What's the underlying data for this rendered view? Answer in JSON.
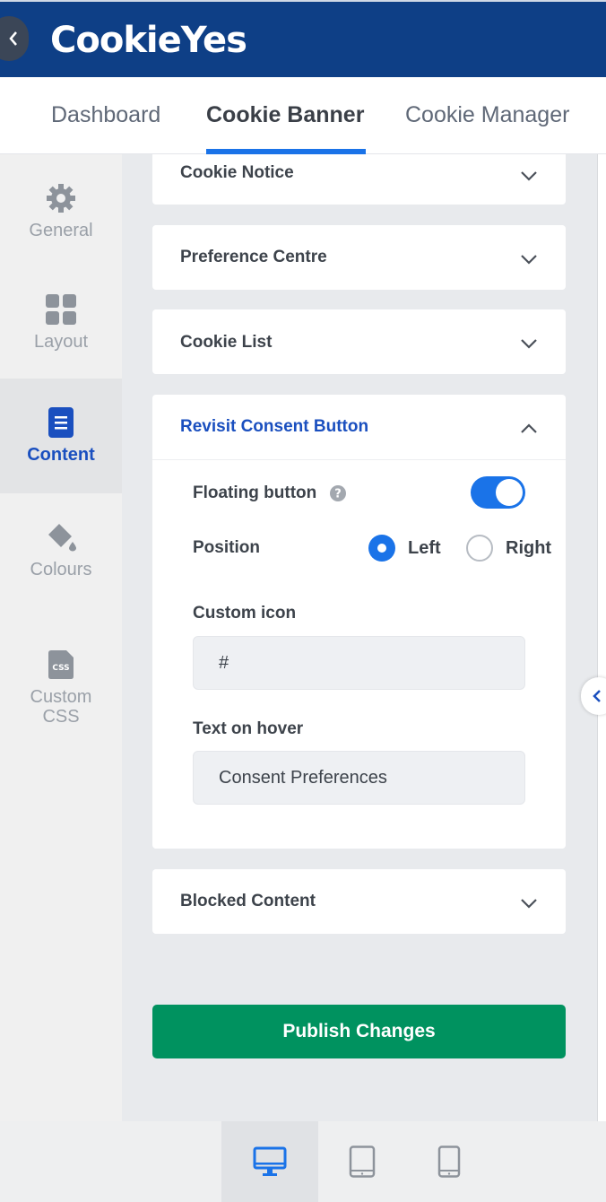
{
  "header": {
    "logo_text": "CookieYes",
    "back_icon": "chevron-left-icon",
    "brand_color": "#0e3f86"
  },
  "tabs": [
    {
      "label": "Dashboard",
      "active": false
    },
    {
      "label": "Cookie Banner",
      "active": true
    },
    {
      "label": "Cookie Manager",
      "active": false
    }
  ],
  "sidebar": {
    "items": [
      {
        "label": "General",
        "icon": "gear-icon",
        "active": false
      },
      {
        "label": "Layout",
        "icon": "grid-icon",
        "active": false
      },
      {
        "label": "Content",
        "icon": "document-icon",
        "active": true
      },
      {
        "label": "Colours",
        "icon": "paint-bucket-icon",
        "active": false
      },
      {
        "label": "Custom CSS",
        "icon": "css-file-icon",
        "active": false
      }
    ]
  },
  "sections": {
    "cookie_notice": "Cookie Notice",
    "preference_centre": "Preference Centre",
    "cookie_list": "Cookie List",
    "revisit": {
      "title": "Revisit Consent Button",
      "floating_label": "Floating button",
      "floating_on": true,
      "position_label": "Position",
      "position_options": [
        "Left",
        "Right"
      ],
      "position_selected": "Left",
      "custom_icon_label": "Custom icon",
      "custom_icon_value": "#",
      "hover_label": "Text on hover",
      "hover_value": "Consent Preferences"
    },
    "blocked_content": "Blocked Content"
  },
  "actions": {
    "publish_label": "Publish Changes",
    "publish_color": "#00925f"
  },
  "devices": [
    {
      "name": "desktop-icon",
      "active": true
    },
    {
      "name": "tablet-icon",
      "active": false
    },
    {
      "name": "mobile-icon",
      "active": false
    }
  ]
}
